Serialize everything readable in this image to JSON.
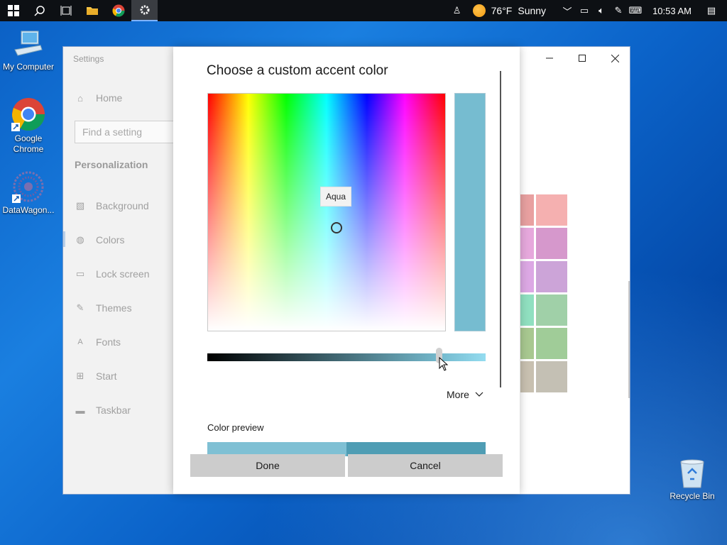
{
  "taskbar": {
    "weather": {
      "temp": "76°F",
      "condition": "Sunny"
    },
    "clock": "10:53 AM"
  },
  "desktop": {
    "icons": [
      {
        "label": "My Computer"
      },
      {
        "label": "Google Chrome"
      },
      {
        "label": "DataWagon..."
      },
      {
        "label": "Recycle Bin"
      }
    ]
  },
  "settings": {
    "window_title": "Settings",
    "home_label": "Home",
    "search_placeholder": "Find a setting",
    "section": "Personalization",
    "nav": [
      {
        "label": "Background",
        "icon": "image-icon"
      },
      {
        "label": "Colors",
        "icon": "palette-icon",
        "selected": true
      },
      {
        "label": "Lock screen",
        "icon": "lock-screen-icon"
      },
      {
        "label": "Themes",
        "icon": "brush-icon"
      },
      {
        "label": "Fonts",
        "icon": "font-icon"
      },
      {
        "label": "Start",
        "icon": "start-icon"
      },
      {
        "label": "Taskbar",
        "icon": "taskbar-icon"
      }
    ]
  },
  "dialog": {
    "title": "Choose a custom accent color",
    "tooltip": "Aqua",
    "selected_color": "#76bcd0",
    "brightness_level": 0.84,
    "more_label": "More",
    "preview_label": "Color preview",
    "done_label": "Done",
    "cancel_label": "Cancel"
  },
  "colors": {
    "accent": "#76bcd0",
    "swatches": [
      "#e8a0a0",
      "#f5b0b0",
      "#e6a8dc",
      "#d698cc",
      "#dca8e4",
      "#cca4d8",
      "#90e0c0",
      "#a0d0a8",
      "#a8c890",
      "#a0cc98",
      "#c8c0b0",
      "#c4c0b4"
    ]
  }
}
